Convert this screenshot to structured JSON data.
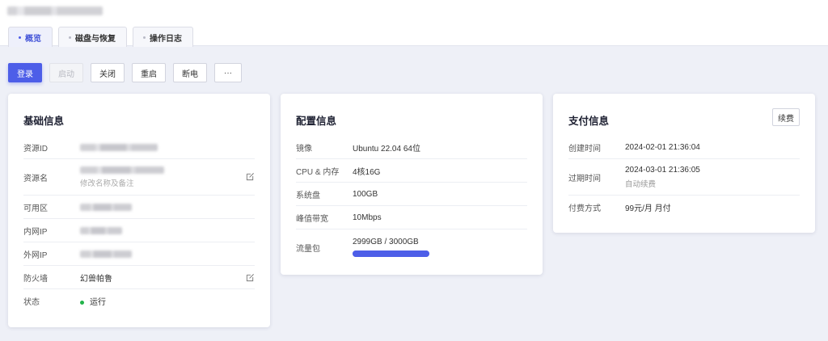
{
  "tabs": [
    {
      "label": "概览",
      "active": true
    },
    {
      "label": "磁盘与恢复",
      "active": false
    },
    {
      "label": "操作日志",
      "active": false
    }
  ],
  "actions": [
    {
      "label": "登录",
      "variant": "primary"
    },
    {
      "label": "启动",
      "variant": "disabled"
    },
    {
      "label": "关闭",
      "variant": "default"
    },
    {
      "label": "重启",
      "variant": "default"
    },
    {
      "label": "断电",
      "variant": "default"
    },
    {
      "label": "···",
      "variant": "default"
    }
  ],
  "basic": {
    "title": "基础信息",
    "resource_id_label": "资源ID",
    "resource_name_label": "资源名",
    "resource_name_hint": "修改名称及备注",
    "zone_label": "可用区",
    "private_ip_label": "内网IP",
    "public_ip_label": "外网IP",
    "firewall_label": "防火墙",
    "firewall_value": "幻兽帕鲁",
    "status_label": "状态",
    "status_value": "运行"
  },
  "config": {
    "title": "配置信息",
    "image_label": "镜像",
    "image_value": "Ubuntu 22.04 64位",
    "cpu_label": "CPU & 内存",
    "cpu_value": "4核16G",
    "disk_label": "系统盘",
    "disk_value": "100GB",
    "bandwidth_label": "峰值带宽",
    "bandwidth_value": "10Mbps",
    "traffic_label": "流量包",
    "traffic_value": "2999GB / 3000GB",
    "traffic_used_fraction": 0.9997
  },
  "payment": {
    "title": "支付信息",
    "renew_label": "续费",
    "created_label": "创建时间",
    "created_value": "2024-02-01 21:36:04",
    "expire_label": "过期时间",
    "expire_value": "2024-03-01 21:36:05",
    "auto_renew": "自动续费",
    "method_label": "付费方式",
    "method_value": "99元/月 月付"
  },
  "colors": {
    "accent": "#4d5ee8",
    "status_running": "#22b34a"
  }
}
